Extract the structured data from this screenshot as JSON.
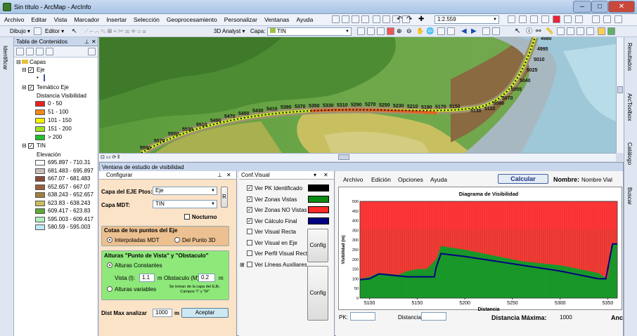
{
  "window": {
    "title": "Sin título - ArcMap - ArcInfo"
  },
  "menu": [
    "Archivo",
    "Editar",
    "Vista",
    "Marcador",
    "Insertar",
    "Selección",
    "Geoprocesamiento",
    "Personalizar",
    "Ventanas",
    "Ayuda"
  ],
  "toolbar": {
    "scale": "1:2.559",
    "dibujo": "Dibujo",
    "editor": "Editor",
    "analyst": "3D Analyst",
    "capa_label": "Capa:",
    "capa_value": "TIN"
  },
  "toc": {
    "title": "Tabla de Contenidos",
    "capas": "Capas",
    "eje": "Eje",
    "tematico": "Temático Eje",
    "dist_header": "Distancia Visibilidad",
    "legend": [
      {
        "label": "0 - 50",
        "color": "#e8221c"
      },
      {
        "label": "51 - 100",
        "color": "#f08a1a"
      },
      {
        "label": "101 - 150",
        "color": "#f4f000"
      },
      {
        "label": "151 - 200",
        "color": "#a0e020"
      },
      {
        "label": "> 200",
        "color": "#22c030"
      }
    ],
    "tin": "TIN",
    "elev_header": "Elevación",
    "elev": [
      {
        "label": "695.897 - 710.31",
        "color": "#ffffff"
      },
      {
        "label": "681.483 - 695.897",
        "color": "#c8c0b8"
      },
      {
        "label": "667.07 - 681.483",
        "color": "#8a4a38"
      },
      {
        "label": "652.657 - 667.07",
        "color": "#9a6040"
      },
      {
        "label": "638.243 - 652.657",
        "color": "#a08040"
      },
      {
        "label": "623.83 - 638.243",
        "color": "#c8c060"
      },
      {
        "label": "609.417 - 623.83",
        "color": "#60a838"
      },
      {
        "label": "595.003 - 609.417",
        "color": "#b0f0c0"
      },
      {
        "label": "580.59 - 595.003",
        "color": "#c0e8f8"
      }
    ]
  },
  "side_tabs": {
    "left": "Identificar",
    "right": [
      "Resultados",
      "ArcToolbox",
      "Catálogo",
      "Buscar"
    ]
  },
  "map_labels": [
    "4980",
    "4995",
    "5010",
    "5025",
    "5040",
    "5055",
    "5070",
    "5090",
    "5110",
    "5130",
    "5150",
    "5170",
    "5190",
    "5210",
    "5230",
    "5250",
    "5270",
    "5290",
    "5310",
    "5330",
    "5350",
    "5370",
    "5390",
    "5410",
    "5430",
    "5450",
    "5470",
    "5490",
    "5510",
    "5530",
    "5550",
    "5570",
    "5590"
  ],
  "panel": {
    "title": "Ventana de estudio de visibilidad",
    "config_tab": "Configurar",
    "capa_eje_label": "Capa del EJE Ptos:",
    "capa_eje": "Eje",
    "capa_mdt_label": "Capa MDT:",
    "capa_mdt": "TIN",
    "r_btn": "R",
    "nocturno": "Nocturno",
    "cotas_title": "Cotas de los puntos del Eje",
    "interpoladas": "Interpoladas MDT",
    "delpunto": "Del Punto 3D",
    "alturas_title": "Alturas \"Punto de Vista\" y \"Obstaculo\"",
    "constantes": "Alturas Constantes",
    "vista_label": "Vista (l):",
    "vista_value": "1.1",
    "m1": "m",
    "obst_label": "Obstaculo (M)",
    "obst_value": "0.2",
    "m2": "m",
    "variables": "Alturas variables",
    "note": "Se toman de la capa del EJE. Campos \"l\" y \"M\"",
    "dist_label": "Dist Max analizar",
    "dist_value": "1000",
    "m3": "m",
    "aceptar": "Aceptar"
  },
  "confvis": {
    "title": "Conf.Visual",
    "rows": [
      {
        "label": "Ver PK Identificado",
        "checked": true,
        "color": "#000000"
      },
      {
        "label": "Ver Zonas Vistas",
        "checked": true,
        "color": "#0a8a14"
      },
      {
        "label": "Ver Zonas NO Vistas",
        "checked": true,
        "color": "#ff2a2a"
      },
      {
        "label": "Ver Cálculo Final",
        "checked": true,
        "color": "#000080"
      },
      {
        "label": "Ver Visual Recta",
        "checked": false
      },
      {
        "label": "Ver Visual en Eje",
        "checked": false
      },
      {
        "label": "Ver Perfil Visual Recta",
        "checked": false
      },
      {
        "label": "Ver Líneas Auxiliares",
        "checked": false
      }
    ],
    "config1": "Config",
    "config2": "Config"
  },
  "viewer": {
    "menu": [
      "Archivo",
      "Edición",
      "Opciones",
      "Ayuda"
    ],
    "calcular": "Calcular",
    "nombre_label": "Nombre:",
    "nombre_value": "Nombre Vial",
    "pk_label": "PK:",
    "distancia_label": "Distancia:",
    "distmax_label": "Distancia Máxima:",
    "distmax_value": "1000",
    "trunc": "Anc"
  },
  "chart_data": {
    "type": "area",
    "title": "Diagrama de Visibilidad",
    "xlabel": "Distancia",
    "ylabel": "Visibilidad (m)",
    "xlim": [
      5090,
      5360
    ],
    "ylim": [
      0,
      500
    ],
    "xticks": [
      5100,
      5150,
      5200,
      5250,
      5300,
      5350
    ],
    "yticks": [
      0,
      50,
      100,
      150,
      200,
      250,
      300,
      350,
      400,
      450,
      500
    ],
    "series": [
      {
        "name": "visible",
        "color": "#0a8a14",
        "x": [
          5090,
          5100,
          5110,
          5120,
          5130,
          5140,
          5150,
          5160,
          5170,
          5175,
          5180,
          5200,
          5220,
          5240,
          5260,
          5280,
          5300,
          5320,
          5340,
          5350,
          5355,
          5360
        ],
        "y": [
          100,
          110,
          130,
          125,
          120,
          140,
          150,
          150,
          200,
          270,
          265,
          250,
          230,
          210,
          190,
          180,
          170,
          150,
          130,
          100,
          280,
          280
        ]
      },
      {
        "name": "final",
        "color": "#000080",
        "x": [
          5090,
          5100,
          5110,
          5120,
          5130,
          5140,
          5150,
          5160,
          5168,
          5170,
          5175,
          5200,
          5220,
          5240,
          5260,
          5280,
          5300,
          5320,
          5340,
          5348,
          5355,
          5360
        ],
        "y": [
          95,
          100,
          125,
          120,
          115,
          110,
          110,
          110,
          110,
          160,
          230,
          215,
          200,
          185,
          170,
          155,
          140,
          120,
          100,
          100,
          280,
          280
        ]
      }
    ]
  }
}
